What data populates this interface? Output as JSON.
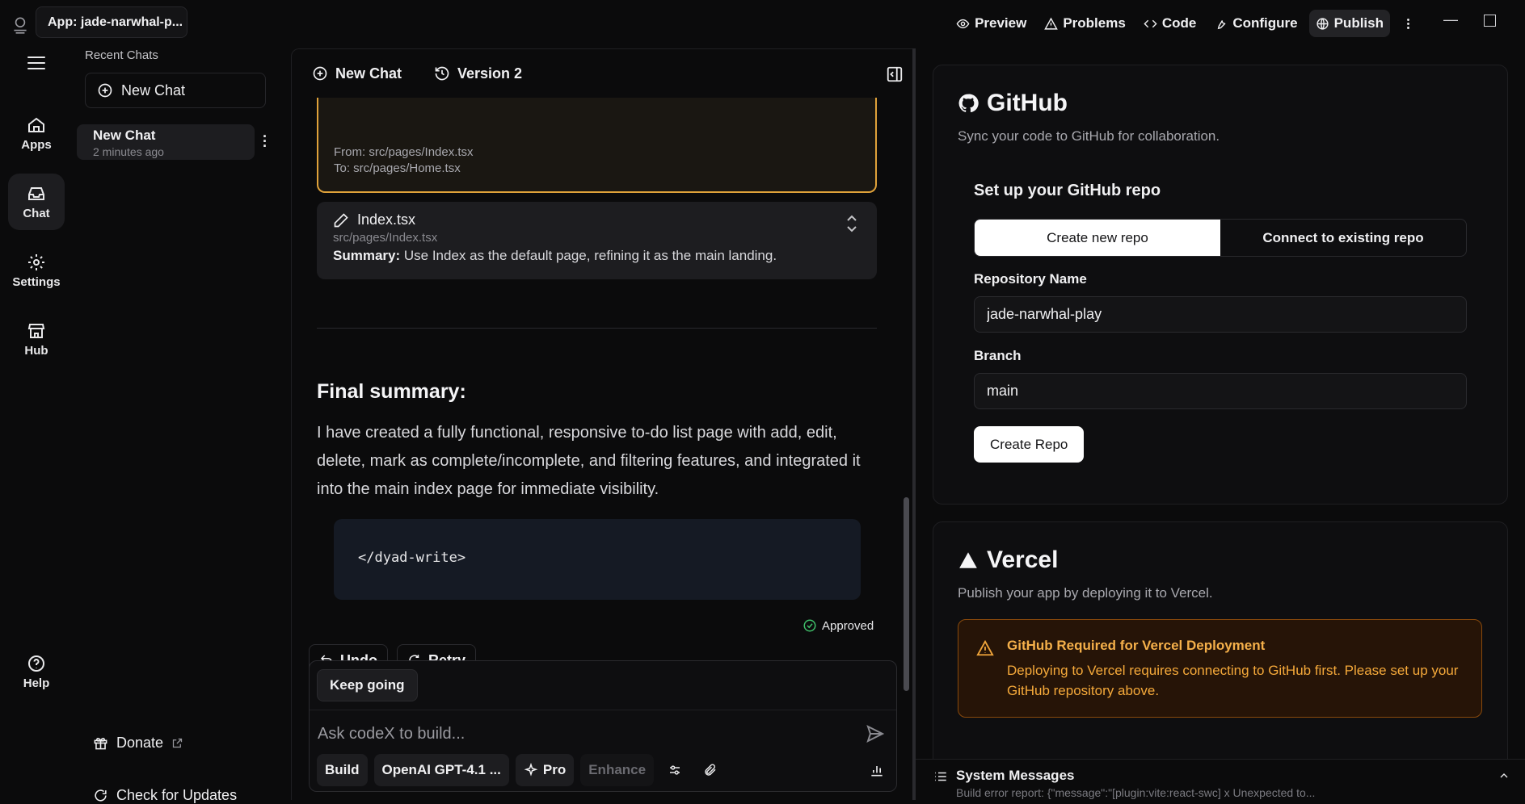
{
  "topbar": {
    "app_name": "App: jade-narwhal-p...",
    "actions": [
      {
        "label": "Preview",
        "icon": "eye-icon"
      },
      {
        "label": "Problems",
        "icon": "warning-icon"
      },
      {
        "label": "Code",
        "icon": "code-icon"
      },
      {
        "label": "Configure",
        "icon": "wrench-icon"
      },
      {
        "label": "Publish",
        "icon": "globe-icon"
      }
    ]
  },
  "rail": {
    "items": [
      {
        "label": "Apps",
        "icon": "home-icon"
      },
      {
        "label": "Chat",
        "icon": "inbox-icon"
      },
      {
        "label": "Settings",
        "icon": "gear-icon"
      },
      {
        "label": "Hub",
        "icon": "store-icon"
      },
      {
        "label": "Help",
        "icon": "help-icon"
      }
    ]
  },
  "chats": {
    "heading": "Recent Chats",
    "new_chat": "New Chat",
    "items": [
      {
        "title": "New Chat",
        "time": "2 minutes ago"
      }
    ],
    "donate": "Donate",
    "updates": "Check for Updates"
  },
  "chat_header": {
    "new_chat": "New Chat",
    "version": "Version 2"
  },
  "messages": {
    "rename_from": "From: src/pages/Index.tsx",
    "rename_to": "To: src/pages/Home.tsx",
    "edit": {
      "file": "Index.tsx",
      "path": "src/pages/Index.tsx",
      "summary_label": "Summary:",
      "summary": "Use Index as the default page, refining it as the main landing."
    },
    "final_title": "Final summary:",
    "final_text": "I have created a fully functional, responsive to-do list page with add, edit, delete, mark as complete/incomplete, and filtering features, and integrated it into the main index page for immediate visibility.",
    "code": "</dyad-write>",
    "approved": "Approved",
    "undo": "Undo",
    "retry": "Retry"
  },
  "composer": {
    "suggestion": "Keep going",
    "placeholder": "Ask codeX to build...",
    "mode": "Build",
    "model": "OpenAI GPT-4.1 ...",
    "pro": "Pro",
    "enhance": "Enhance"
  },
  "github": {
    "title": "GitHub",
    "subtitle": "Sync your code to GitHub for collaboration.",
    "setup_title": "Set up your GitHub repo",
    "tab_new": "Create new repo",
    "tab_existing": "Connect to existing repo",
    "repo_label": "Repository Name",
    "repo_value": "jade-narwhal-play",
    "branch_label": "Branch",
    "branch_value": "main",
    "create_button": "Create Repo"
  },
  "vercel": {
    "title": "Vercel",
    "subtitle": "Publish your app by deploying it to Vercel.",
    "warning_title": "GitHub Required for Vercel Deployment",
    "warning_text": "Deploying to Vercel requires connecting to GitHub first. Please set up your GitHub repository above."
  },
  "system_messages": {
    "title": "System Messages",
    "preview": "Build error report: {\"message\":\"[plugin:vite:react-swc] x Unexpected to..."
  }
}
